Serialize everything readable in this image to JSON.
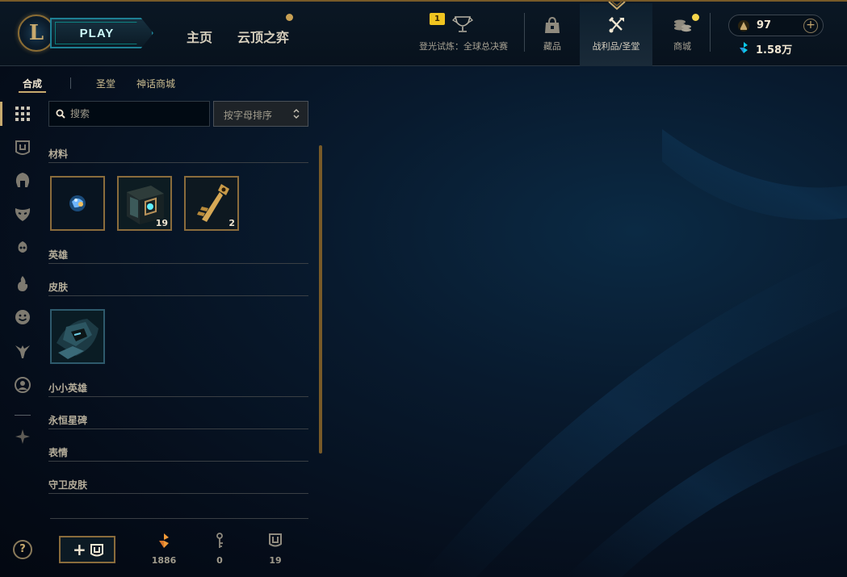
{
  "header": {
    "logo_letter": "L",
    "play_label": "PLAY",
    "nav": {
      "home": "主页",
      "tft": "云顶之弈"
    },
    "worlds": {
      "badge": "1",
      "label": "登光试炼：全球总决赛"
    },
    "tabs": [
      {
        "label": "藏品",
        "icon": "collection-bag-icon"
      },
      {
        "label": "战利品/圣堂",
        "icon": "loot-crafting-icon"
      },
      {
        "label": "商城",
        "icon": "store-coins-icon"
      }
    ],
    "rp": {
      "value": "97",
      "plus": "+"
    },
    "be": {
      "value": "1.58万"
    }
  },
  "subtabs": {
    "craft": "合成",
    "sanctum": "圣堂",
    "mythic_shop": "神话商城"
  },
  "search": {
    "placeholder": "搜索"
  },
  "sort": {
    "label": "按字母排序"
  },
  "categories": {
    "materials": "材料",
    "champions": "英雄",
    "skins": "皮肤",
    "little_legends": "小小英雄",
    "eternals": "永恒星碑",
    "emotes": "表情",
    "ward_skins": "守卫皮肤"
  },
  "materials_items": [
    {
      "name": "orb",
      "count": ""
    },
    {
      "name": "hextech-chest",
      "count": "19"
    },
    {
      "name": "hextech-key",
      "count": "2"
    }
  ],
  "footer": {
    "add_plus": "+",
    "orange_essence": "1886",
    "keys": "0",
    "chests": "19"
  },
  "help": "?",
  "colors": {
    "gold": "#c8aa6e",
    "gold_dark": "#785a28",
    "teal": "#0ac8b9",
    "bg": "#050d1a"
  }
}
